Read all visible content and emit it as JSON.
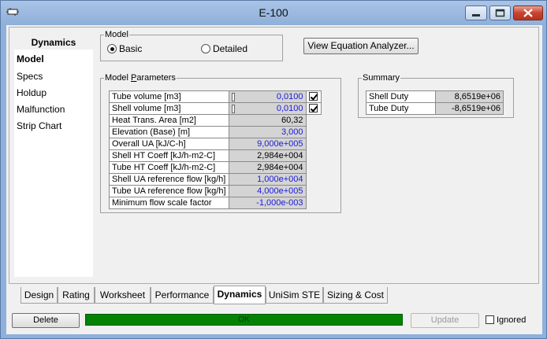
{
  "window": {
    "title": "E-100"
  },
  "nav": {
    "header": "Dynamics",
    "items": [
      "Model",
      "Specs",
      "Holdup",
      "Malfunction",
      "Strip Chart"
    ],
    "active": "Model"
  },
  "model_group": {
    "legend": "Model",
    "options": [
      {
        "label": "Basic",
        "selected": true
      },
      {
        "label": "Detailed",
        "selected": false
      }
    ]
  },
  "equation_button": "View Equation Analyzer...",
  "parameters": {
    "legend": "Model Parameters",
    "rows": [
      {
        "label": "Tube volume [m3]",
        "value": "0,0100",
        "color": "blue",
        "checkbox": true,
        "checked": true
      },
      {
        "label": "Shell volume [m3]",
        "value": "0,0100",
        "color": "blue",
        "checkbox": true,
        "checked": true
      },
      {
        "label": "Heat Trans. Area [m2]",
        "value": "60,32",
        "color": "black"
      },
      {
        "label": "Elevation (Base) [m]",
        "value": "3,000",
        "color": "blue"
      },
      {
        "label": "Overall UA [kJ/C-h]",
        "value": "9,000e+005",
        "color": "blue"
      },
      {
        "label": "Shell HT Coeff [kJ/h-m2-C]",
        "value": "2,984e+004",
        "color": "black"
      },
      {
        "label": "Tube HT Coeff [kJ/h-m2-C]",
        "value": "2,984e+004",
        "color": "black"
      },
      {
        "label": "Shell UA reference flow [kg/h]",
        "value": "1,000e+004",
        "color": "blue"
      },
      {
        "label": "Tube UA reference flow [kg/h]",
        "value": "4,000e+005",
        "color": "blue"
      },
      {
        "label": "Minimum flow scale factor",
        "value": "-1,000e-003",
        "color": "blue"
      }
    ]
  },
  "summary": {
    "legend": "Summary",
    "rows": [
      {
        "label": "Shell Duty",
        "value": "8,6519e+06"
      },
      {
        "label": "Tube Duty",
        "value": "-8,6519e+06"
      }
    ]
  },
  "tabs": [
    "Design",
    "Rating",
    "Worksheet",
    "Performance",
    "Dynamics",
    "UniSim STE",
    "Sizing & Cost"
  ],
  "active_tab": "Dynamics",
  "footer": {
    "delete_label": "Delete",
    "status": "OK",
    "update_label": "Update",
    "ignored_label": "Ignored",
    "ignored_checked": false
  },
  "colors": {
    "status_bar": "#038203",
    "blue_value": "#1a1adc"
  }
}
